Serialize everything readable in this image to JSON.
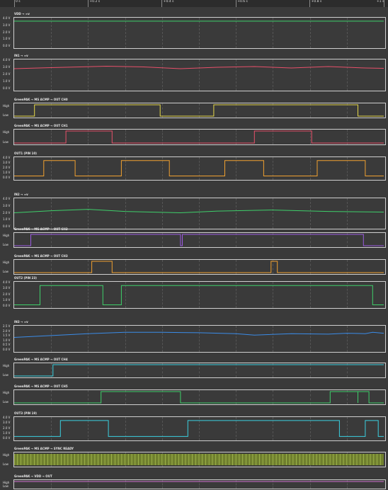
{
  "timeline": {
    "ticks": [
      {
        "label": "0 s",
        "t": 0.0
      },
      {
        "label": "+0.2 s",
        "t": 0.2
      },
      {
        "label": "+0.4 s",
        "t": 0.4
      },
      {
        "label": "+0.6 s",
        "t": 0.6
      },
      {
        "label": "+0.8 s",
        "t": 0.8
      },
      {
        "label": "+1 s",
        "t": 1.0
      }
    ]
  },
  "colors": {
    "green": "#3ecf6a",
    "red": "#e8506a",
    "yellow": "#e6d84a",
    "orange": "#f0a030",
    "purple": "#9a5ae0",
    "blue": "#3a8ce8",
    "cyan": "#3ad0e0",
    "olive": "#a8c050",
    "magenta": "#d070d0"
  },
  "channels": [
    {
      "title": "VDD → ∞v",
      "type": "analog",
      "color": "#3ecf6a",
      "y_labels": [
        "4.0 V",
        "3.0 V",
        "2.0 V",
        "1.0 V",
        "0.0 V"
      ],
      "ymax": 4,
      "points": [
        [
          0,
          3.7
        ],
        [
          1,
          3.7
        ]
      ]
    },
    {
      "title": "IN1 → ∞v",
      "type": "analog",
      "color": "#e8506a",
      "y_labels": [
        "4.0 V",
        "3.0 V",
        "2.0 V",
        "1.0 V",
        "0.0 V"
      ],
      "ymax": 4,
      "points": [
        [
          0,
          2.9
        ],
        [
          0.1,
          3.05
        ],
        [
          0.25,
          3.25
        ],
        [
          0.35,
          3.15
        ],
        [
          0.45,
          2.9
        ],
        [
          0.55,
          3.1
        ],
        [
          0.65,
          3.2
        ],
        [
          0.75,
          3.0
        ],
        [
          0.85,
          3.2
        ],
        [
          0.95,
          3.0
        ],
        [
          1,
          2.95
        ]
      ]
    },
    {
      "title": "GreenPAK → MS ACMP → OUT CH0",
      "type": "digital",
      "color": "#e6d84a",
      "y_labels": [
        "High",
        "Low"
      ],
      "initial": 0,
      "edges": [
        0.055,
        0.395,
        0.54,
        0.93
      ]
    },
    {
      "title": "GreenPAK → MS ACMP → OUT CH1",
      "type": "digital",
      "color": "#e8506a",
      "y_labels": [
        "High",
        "Low"
      ],
      "initial": 0,
      "edges": [
        0.14,
        0.265,
        0.65,
        0.805
      ]
    },
    {
      "title": "OUT1 (PIN 10)",
      "type": "digital",
      "color": "#f0a030",
      "y_labels": [
        "4.0 V",
        "3.0 V",
        "2.0 V",
        "1.0 V",
        "0.0 V"
      ],
      "ymax": 4,
      "low": 0.5,
      "high": 3.6,
      "initial": 0,
      "edges": [
        0.08,
        0.165,
        0.29,
        0.42,
        0.57,
        0.675,
        0.82,
        0.95
      ]
    },
    {
      "title": "IN2 → ∞v",
      "type": "analog",
      "color": "#3ecf6a",
      "y_labels": [
        "4.0 V",
        "3.0 V",
        "2.0 V",
        "1.0 V",
        "0.0 V"
      ],
      "ymax": 4,
      "points": [
        [
          0,
          2.1
        ],
        [
          0.1,
          2.4
        ],
        [
          0.2,
          2.6
        ],
        [
          0.3,
          2.3
        ],
        [
          0.45,
          2.1
        ],
        [
          0.55,
          2.35
        ],
        [
          0.7,
          2.5
        ],
        [
          0.85,
          2.3
        ],
        [
          1,
          2.2
        ]
      ]
    },
    {
      "title": "GreenPAK → MS ACMP → OUT CH2",
      "type": "digital",
      "color": "#9a5ae0",
      "y_labels": [
        "High",
        "Low"
      ],
      "initial": 0,
      "edges": [
        0.045,
        0.45,
        0.455,
        0.945
      ]
    },
    {
      "title": "GreenPAK → MS ACMP → OUT CH3",
      "type": "digital",
      "color": "#f0a030",
      "y_labels": [
        "High",
        "Low"
      ],
      "initial": 0,
      "edges": [
        0.21,
        0.265,
        0.695,
        0.712
      ]
    },
    {
      "title": "OUT2 (PIN 23)",
      "type": "digital",
      "color": "#3ecf6a",
      "y_labels": [
        "4.0 V",
        "3.0 V",
        "2.0 V",
        "1.0 V",
        "0.0 V"
      ],
      "ymax": 4,
      "low": 0.3,
      "high": 3.6,
      "initial": 0,
      "edges": [
        0.07,
        0.24,
        0.29,
        0.97
      ]
    },
    {
      "title": "IN3 → ∞v",
      "type": "analog",
      "color": "#3a8ce8",
      "y_labels": [
        "2.5 V",
        "2.0 V",
        "1.5 V",
        "1.0 V",
        "0.5 V",
        "0.0 V"
      ],
      "ymax": 2.5,
      "points": [
        [
          0,
          1.4
        ],
        [
          0.1,
          1.6
        ],
        [
          0.2,
          1.8
        ],
        [
          0.3,
          1.95
        ],
        [
          0.4,
          1.95
        ],
        [
          0.5,
          1.9
        ],
        [
          0.6,
          1.8
        ],
        [
          0.65,
          1.65
        ],
        [
          0.75,
          1.8
        ],
        [
          0.85,
          1.75
        ],
        [
          0.9,
          1.85
        ],
        [
          0.95,
          1.8
        ],
        [
          0.97,
          1.95
        ],
        [
          1,
          1.85
        ]
      ]
    },
    {
      "title": "GreenPAK → MS ACMP → OUT CH4",
      "type": "digital",
      "color": "#3ad0e0",
      "y_labels": [
        "High",
        "Low"
      ],
      "initial": 0,
      "edges": [
        0.105
      ]
    },
    {
      "title": "GreenPAK → MS ACMP → OUT CH5",
      "type": "digital",
      "color": "#3ecf6a",
      "y_labels": [
        "High",
        "Low"
      ],
      "initial": 0,
      "edges": [
        0.235,
        0.45,
        0.855,
        0.93,
        0.93,
        0.96
      ]
    },
    {
      "title": "OUT3 (PIN 19)",
      "type": "digital",
      "color": "#3ad0e0",
      "y_labels": [
        "4.0 V",
        "3.0 V",
        "2.0 V",
        "1.0 V",
        "0.0 V"
      ],
      "ymax": 4,
      "low": 0.5,
      "high": 3.6,
      "initial": 0,
      "edges": [
        0.125,
        0.255,
        0.47,
        0.88,
        0.95,
        0.985
      ]
    },
    {
      "title": "GreenPAK → MS ACMP → SYNC READY",
      "type": "clock",
      "color": "#a8c050",
      "y_labels": [
        "High",
        "Low"
      ],
      "cycles": 110
    },
    {
      "title": "GreenPAK → VDD → OUT",
      "type": "digital",
      "color": "#d070d0",
      "y_labels": [
        "High",
        "Low"
      ],
      "initial": 1,
      "edges": []
    }
  ]
}
